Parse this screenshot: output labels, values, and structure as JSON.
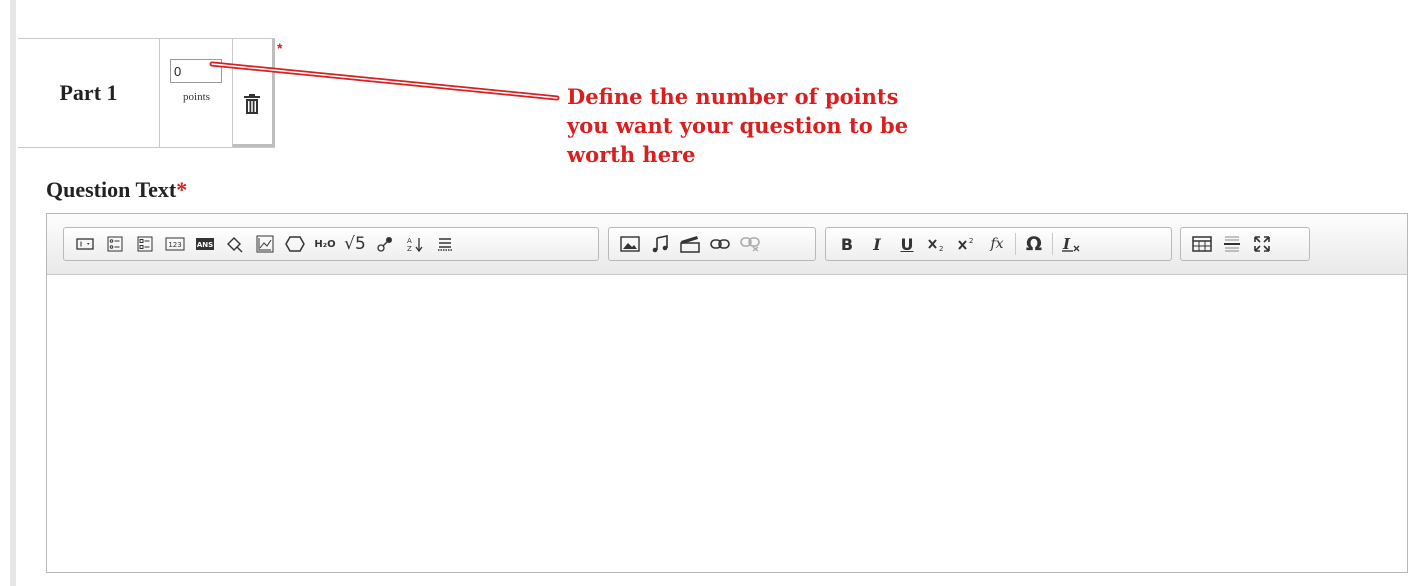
{
  "part": {
    "label": "Part 1",
    "points_value": "0",
    "points_label": "points",
    "required_marker": "*"
  },
  "annotation": {
    "text": "Define the number of points you want your question to be worth here",
    "color": "#d91f1f"
  },
  "question_text": {
    "label": "Question Text",
    "required_marker": "*"
  },
  "toolbar": {
    "groups": [
      {
        "name": "insert-question-elements",
        "buttons": [
          "textbox-icon",
          "multiple-choice-icon",
          "checkbox-list-icon",
          "numeric-icon",
          "answer-icon",
          "geometry-icon",
          "graph-icon",
          "hexagon-icon",
          "chem-formula-icon",
          "sqrt-icon",
          "molecule-icon",
          "sort-icon",
          "matching-icon"
        ]
      },
      {
        "name": "media",
        "buttons": [
          "image-icon",
          "audio-icon",
          "video-icon",
          "link-icon",
          "unlink-icon"
        ]
      },
      {
        "name": "formatting",
        "buttons": [
          "bold-icon",
          "italic-icon",
          "underline-icon",
          "subscript-icon",
          "superscript-icon",
          "formula-icon",
          "special-char-icon",
          "remove-format-icon"
        ]
      },
      {
        "name": "layout",
        "buttons": [
          "table-icon",
          "horizontal-rule-icon",
          "maximize-icon"
        ]
      }
    ],
    "labels": {
      "chem": "H₂O",
      "sqrt": "√5",
      "bold": "B",
      "italic": "I",
      "underline": "U",
      "fx": "fx",
      "omega": "Ω"
    }
  },
  "colors": {
    "required": "#d31f1f",
    "annotation": "#d91f1f"
  }
}
